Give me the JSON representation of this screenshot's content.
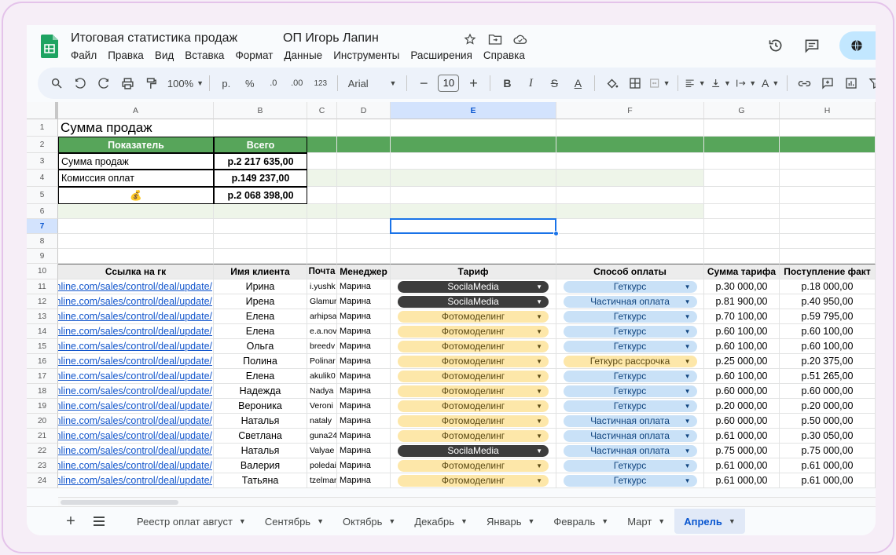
{
  "doc": {
    "title": "Итоговая статистика продаж             ОП Игорь Лапин"
  },
  "menu": [
    "Файл",
    "Правка",
    "Вид",
    "Вставка",
    "Формат",
    "Данные",
    "Инструменты",
    "Расширения",
    "Справка"
  ],
  "toolbar": {
    "zoom": "100%",
    "currency": "р.",
    "percent": "%",
    "dec_less": ".0",
    "dec_more": ".00",
    "number_fmt": "123",
    "font": "Arial",
    "font_size": "10"
  },
  "columns": [
    "A",
    "B",
    "C",
    "D",
    "E",
    "F",
    "G",
    "H"
  ],
  "rows": [
    "1",
    "2",
    "3",
    "4",
    "5",
    "6",
    "7",
    "8",
    "9",
    "10",
    "11",
    "12",
    "13",
    "14",
    "15",
    "16",
    "17",
    "18",
    "19",
    "20",
    "21",
    "22",
    "23",
    "24"
  ],
  "summary": {
    "title": "Сумма продаж",
    "h_indicator": "Показатель",
    "h_total": "Всего",
    "r1_label": "Сумма продаж",
    "r1_value": "р.2 217 635,00",
    "r2_label": "Комиссия оплат",
    "r2_value": "р.149 237,00",
    "r3_label": "💰",
    "r3_value": "р.2 068 398,00"
  },
  "table": {
    "headers": [
      "Ссылка на гк",
      "Имя клиента",
      "Почта",
      "Менеджер",
      "Тариф",
      "Способ оплаты",
      "Сумма тарифа",
      "Поступление факт"
    ],
    "rows": [
      {
        "link": "online.com/sales/control/deal/update/",
        "name": "Ирина",
        "mail": "i.yushk",
        "manager": "Марина",
        "tariff": "SocilaMedia",
        "tariff_style": "dark",
        "pay": "Геткурс",
        "pay_style": "blue",
        "sum": "р.30 000,00",
        "fact": "р.18 000,00"
      },
      {
        "link": "online.com/sales/control/deal/update/",
        "name": "Ирена",
        "mail": "Glamur",
        "manager": "Марина",
        "tariff": "SocilaMedia",
        "tariff_style": "dark",
        "pay": "Частичная оплата",
        "pay_style": "blue",
        "sum": "р.81 900,00",
        "fact": "р.40 950,00"
      },
      {
        "link": "online.com/sales/control/deal/update/",
        "name": "Елена",
        "mail": "arhipsa",
        "manager": "Марина",
        "tariff": "Фотомоделинг",
        "tariff_style": "yellow",
        "pay": "Геткурс",
        "pay_style": "blue",
        "sum": "р.70 100,00",
        "fact": "р.59 795,00"
      },
      {
        "link": "online.com/sales/control/deal/update/",
        "name": "Елена",
        "mail": "e.a.nov",
        "manager": "Марина",
        "tariff": "Фотомоделинг",
        "tariff_style": "yellow",
        "pay": "Геткурс",
        "pay_style": "blue",
        "sum": "р.60 100,00",
        "fact": "р.60 100,00"
      },
      {
        "link": "online.com/sales/control/deal/update/",
        "name": "Ольга",
        "mail": "breedv",
        "manager": "Марина",
        "tariff": "Фотомоделинг",
        "tariff_style": "yellow",
        "pay": "Геткурс",
        "pay_style": "blue",
        "sum": "р.60 100,00",
        "fact": "р.60 100,00"
      },
      {
        "link": "online.com/sales/control/deal/update/",
        "name": "Полина",
        "mail": "Polinar",
        "manager": "Марина",
        "tariff": "Фотомоделинг",
        "tariff_style": "yellow",
        "pay": "Геткурс рассрочка",
        "pay_style": "orange",
        "sum": "р.25 000,00",
        "fact": "р.20 375,00"
      },
      {
        "link": "online.com/sales/control/deal/update/",
        "name": "Елена",
        "mail": "akulik0",
        "manager": "Марина",
        "tariff": "Фотомоделинг",
        "tariff_style": "yellow",
        "pay": "Геткурс",
        "pay_style": "blue",
        "sum": "р.60 100,00",
        "fact": "р.51 265,00"
      },
      {
        "link": "online.com/sales/control/deal/update/",
        "name": "Надежда",
        "mail": "Nadya",
        "manager": "Марина",
        "tariff": "Фотомоделинг",
        "tariff_style": "yellow",
        "pay": "Геткурс",
        "pay_style": "blue",
        "sum": "р.60 000,00",
        "fact": "р.60 000,00"
      },
      {
        "link": "online.com/sales/control/deal/update/",
        "name": "Вероника",
        "mail": "Veroni",
        "manager": "Марина",
        "tariff": "Фотомоделинг",
        "tariff_style": "yellow",
        "pay": "Геткурс",
        "pay_style": "blue",
        "sum": "р.20 000,00",
        "fact": "р.20 000,00"
      },
      {
        "link": "online.com/sales/control/deal/update/",
        "name": "Наталья",
        "mail": "nataly",
        "manager": "Марина",
        "tariff": "Фотомоделинг",
        "tariff_style": "yellow",
        "pay": "Частичная оплата",
        "pay_style": "blue",
        "sum": "р.60 000,00",
        "fact": "р.50 000,00"
      },
      {
        "link": "online.com/sales/control/deal/update/",
        "name": "Светлана",
        "mail": "guna24",
        "manager": "Марина",
        "tariff": "Фотомоделинг",
        "tariff_style": "yellow",
        "pay": "Частичная оплата",
        "pay_style": "blue",
        "sum": "р.61 000,00",
        "fact": "р.30 050,00"
      },
      {
        "link": "online.com/sales/control/deal/update/",
        "name": "Наталья",
        "mail": "Valyae",
        "manager": "Марина",
        "tariff": "SocilaMedia",
        "tariff_style": "dark",
        "pay": "Частичная оплата",
        "pay_style": "blue",
        "sum": "р.75 000,00",
        "fact": "р.75 000,00"
      },
      {
        "link": "online.com/sales/control/deal/update/",
        "name": "Валерия",
        "mail": "poledai",
        "manager": "Марина",
        "tariff": "Фотомоделинг",
        "tariff_style": "yellow",
        "pay": "Геткурс",
        "pay_style": "blue",
        "sum": "р.61 000,00",
        "fact": "р.61 000,00"
      },
      {
        "link": "online.com/sales/control/deal/update/",
        "name": "Татьяна",
        "mail": "tzelmar",
        "manager": "Марина",
        "tariff": "Фотомоделинг",
        "tariff_style": "yellow",
        "pay": "Геткурс",
        "pay_style": "blue",
        "sum": "р.61 000,00",
        "fact": "р.61 000,00"
      }
    ]
  },
  "tabs": [
    {
      "label": "Реестр оплат август",
      "active": false
    },
    {
      "label": "Сентябрь",
      "active": false
    },
    {
      "label": "Октябрь",
      "active": false
    },
    {
      "label": "Декабрь",
      "active": false
    },
    {
      "label": "Январь",
      "active": false
    },
    {
      "label": "Февраль",
      "active": false
    },
    {
      "label": "Март",
      "active": false
    },
    {
      "label": "Апрель",
      "active": true
    }
  ],
  "colors": {
    "accent": "#0b57d0",
    "green_header": "#57a55a",
    "dark_chip": "#3c3c3c",
    "yellow_chip": "#fde7a9",
    "blue_chip": "#c9e1f7"
  }
}
